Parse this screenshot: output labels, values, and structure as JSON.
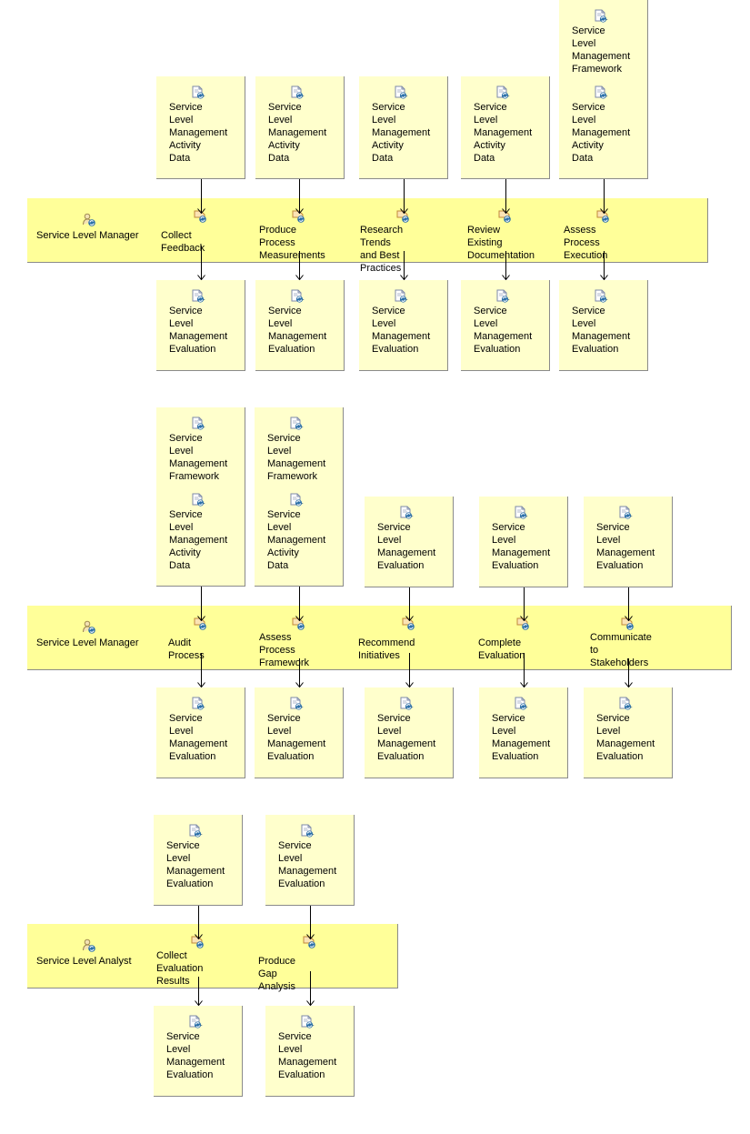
{
  "colors": {
    "artifact_bg": "#ffffcc",
    "lane_bg": "#ffff99",
    "border": "#8a8a8a",
    "connector": "#000000"
  },
  "icons": {
    "artifact": "work-product-icon",
    "role": "role-icon",
    "task": "task-icon"
  },
  "diagrams": [
    {
      "role": "Service Level Manager",
      "tasks": [
        {
          "label": "Collect Feedback",
          "inputs": [
            [
              "Service\nLevel\nManagement\nActivity\nData"
            ]
          ],
          "outputs": [
            "Service\nLevel\nManagement\nEvaluation"
          ]
        },
        {
          "label": "Produce Process\nMeasurements",
          "inputs": [
            [
              "Service\nLevel\nManagement\nActivity\nData"
            ]
          ],
          "outputs": [
            "Service\nLevel\nManagement\nEvaluation"
          ]
        },
        {
          "label": "Research Trends\nand Best Practices",
          "inputs": [
            [
              "Service\nLevel\nManagement\nActivity\nData"
            ]
          ],
          "outputs": [
            "Service\nLevel\nManagement\nEvaluation"
          ]
        },
        {
          "label": "Review Existing\nDocumentation",
          "inputs": [
            [
              "Service\nLevel\nManagement\nActivity\nData"
            ]
          ],
          "outputs": [
            "Service\nLevel\nManagement\nEvaluation"
          ]
        },
        {
          "label": "Assess Process\nExecution",
          "inputs": [
            [
              "Service\nLevel\nManagement\nFramework",
              "Service\nLevel\nManagement\nActivity\nData"
            ]
          ],
          "outputs": [
            "Service\nLevel\nManagement\nEvaluation"
          ]
        }
      ]
    },
    {
      "role": "Service Level Manager",
      "tasks": [
        {
          "label": "Audit Process",
          "inputs": [
            [
              "Service\nLevel\nManagement\nFramework",
              "Service\nLevel\nManagement\nActivity\nData"
            ]
          ],
          "outputs": [
            "Service\nLevel\nManagement\nEvaluation"
          ]
        },
        {
          "label": "Assess Process\nFramework",
          "inputs": [
            [
              "Service\nLevel\nManagement\nFramework",
              "Service\nLevel\nManagement\nActivity\nData"
            ]
          ],
          "outputs": [
            "Service\nLevel\nManagement\nEvaluation"
          ]
        },
        {
          "label": "Recommend Initiatives",
          "inputs": [
            [
              "Service\nLevel\nManagement\nEvaluation"
            ]
          ],
          "outputs": [
            "Service\nLevel\nManagement\nEvaluation"
          ]
        },
        {
          "label": "Complete Evaluation",
          "inputs": [
            [
              "Service\nLevel\nManagement\nEvaluation"
            ]
          ],
          "outputs": [
            "Service\nLevel\nManagement\nEvaluation"
          ]
        },
        {
          "label": "Communicate to\nStakeholders",
          "inputs": [
            [
              "Service\nLevel\nManagement\nEvaluation"
            ]
          ],
          "outputs": [
            "Service\nLevel\nManagement\nEvaluation"
          ]
        }
      ]
    },
    {
      "role": "Service Level Analyst",
      "tasks": [
        {
          "label": "Collect Evaluation\nResults",
          "inputs": [
            [
              "Service\nLevel\nManagement\nEvaluation"
            ]
          ],
          "outputs": [
            "Service\nLevel\nManagement\nEvaluation"
          ]
        },
        {
          "label": "Produce Gap Analysis",
          "inputs": [
            [
              "Service\nLevel\nManagement\nEvaluation"
            ]
          ],
          "outputs": [
            "Service\nLevel\nManagement\nEvaluation"
          ]
        }
      ]
    }
  ]
}
